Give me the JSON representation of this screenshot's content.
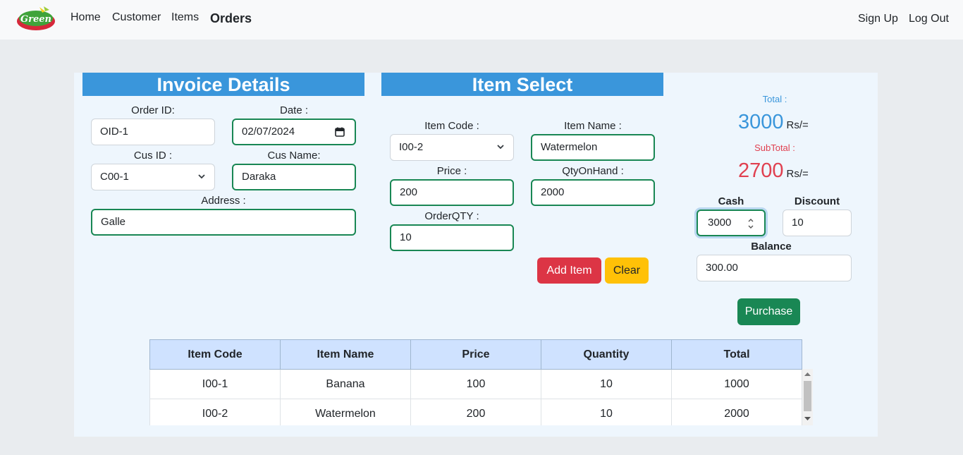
{
  "nav": {
    "logo_alt": "The Green",
    "links": [
      "Home",
      "Customer",
      "Items"
    ],
    "active": "Orders",
    "right": [
      "Sign Up",
      "Log Out"
    ]
  },
  "invoice": {
    "header": "Invoice Details",
    "order_id_label": "Order ID:",
    "order_id": "OID-1",
    "date_label": "Date :",
    "date": "02/07/2024",
    "cus_id_label": "Cus ID :",
    "cus_id": "C00-1",
    "cus_name_label": "Cus Name:",
    "cus_name": "Daraka",
    "address_label": "Address :",
    "address": "Galle"
  },
  "item_select": {
    "header": "Item Select",
    "item_code_label": "Item Code :",
    "item_code": "I00-2",
    "item_name_label": "Item Name :",
    "item_name": "Watermelon",
    "price_label": "Price :",
    "price": "200",
    "qty_on_hand_label": "QtyOnHand :",
    "qty_on_hand": "2000",
    "order_qty_label": "OrderQTY :",
    "order_qty": "10",
    "add_button": "Add Item",
    "clear_button": "Clear"
  },
  "summary": {
    "total_label": "Total :",
    "total": "3000",
    "subtotal_label": "SubTotal :",
    "subtotal": "2700",
    "unit": "Rs/=",
    "cash_label": "Cash",
    "cash": "3000",
    "discount_label": "Discount",
    "discount": "10",
    "balance_label": "Balance",
    "balance": "300.00",
    "purchase_button": "Purchase"
  },
  "colors": {
    "total": "#3a96db",
    "subtotal": "#e04050"
  },
  "table": {
    "headers": [
      "Item Code",
      "Item Name",
      "Price",
      "Quantity",
      "Total"
    ],
    "rows": [
      [
        "I00-1",
        "Banana",
        "100",
        "10",
        "1000"
      ],
      [
        "I00-2",
        "Watermelon",
        "200",
        "10",
        "2000"
      ]
    ]
  }
}
